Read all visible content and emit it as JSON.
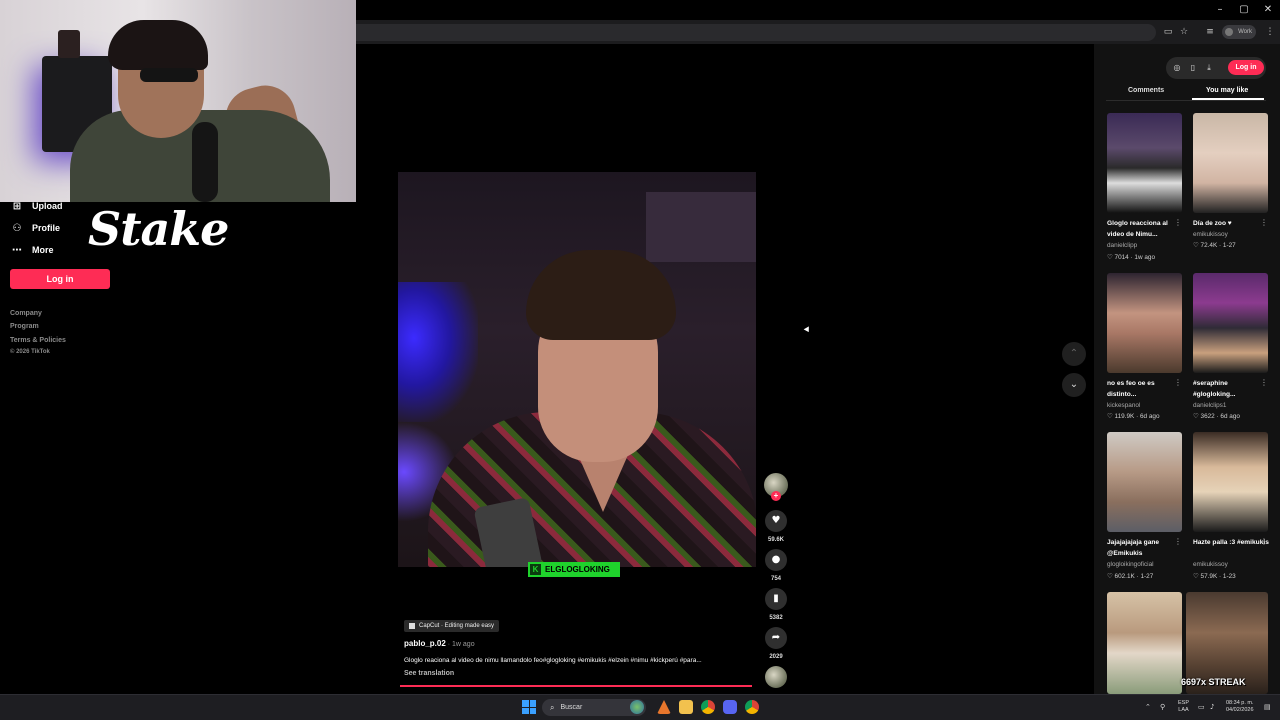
{
  "browser": {
    "window_controls": {
      "minimize": "–",
      "maximize": "▢",
      "close": "✕"
    },
    "profile_label": "Work",
    "toolbar_icons": [
      "cast-icon",
      "star-icon",
      "playlist-icon"
    ]
  },
  "sidebar": {
    "items": [
      {
        "label": "Upload",
        "icon": "⊞"
      },
      {
        "label": "Profile",
        "icon": "⚇"
      },
      {
        "label": "More",
        "icon": "⋯"
      }
    ],
    "login_label": "Log in",
    "footer": [
      "Company",
      "Program",
      "Terms & Policies",
      "© 2026 TikTok"
    ]
  },
  "sponsor": {
    "logo_text": "Stake"
  },
  "video": {
    "watermark": "ELGLOGLOKING",
    "capcut_label": "CapCut · Editing made easy",
    "author": "pablo_p.02",
    "posted": " · 1w ago",
    "caption": "Gloglo reaciona al video de nimu llamandolo feo#glogloking #emikukis #elzein #nimu #kickperú #para...",
    "see_translation": "See translation",
    "progress": 1.0,
    "actions": {
      "likes": "59.6K",
      "comments": "754",
      "saves": "5382",
      "shares": "2029"
    }
  },
  "right_panel": {
    "login_label": "Log in",
    "tabs": [
      "Comments",
      "You may like"
    ],
    "active_tab": "You may like",
    "recommendations": [
      {
        "title": "Gloglo reacciona al video de Nimu...",
        "user": "danielclipp",
        "likes": "7014",
        "age": "1w ago"
      },
      {
        "title": "Día de zoo ♥",
        "user": "emikukissoy",
        "likes": "72.4K",
        "age": "1-27"
      },
      {
        "title": "no es feo oe es distinto...",
        "user": "kickespanol",
        "likes": "119.9K",
        "age": "6d ago"
      },
      {
        "title": "#seraphine #glogloking...",
        "user": "danielclips1",
        "likes": "3622",
        "age": "6d ago"
      },
      {
        "title": "Jajajajajaja gane @Emikukis",
        "user": "glogloikingoficial",
        "likes": "602.1K",
        "age": "1-27"
      },
      {
        "title": "Hazte palla :3 #emikukis",
        "user": "emikukissoy",
        "likes": "57.9K",
        "age": "1-23"
      }
    ],
    "streak_text": "6697x STREAK"
  },
  "taskbar": {
    "search_placeholder": "Buscar",
    "lang": [
      "ESP",
      "LAA"
    ],
    "time": "08:34 p. m.",
    "date": "04/02/2026"
  },
  "colors": {
    "accent": "#fe2c55",
    "watermark": "#1fd22c"
  }
}
